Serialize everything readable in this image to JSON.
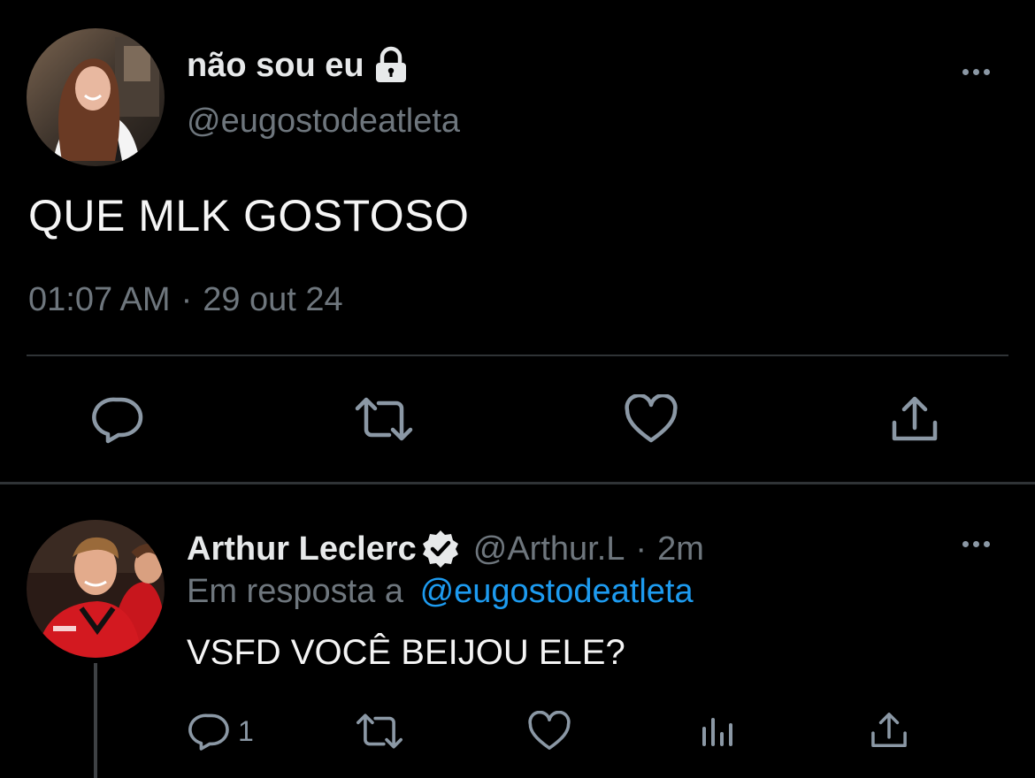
{
  "main_tweet": {
    "display_name": "não sou eu",
    "handle": "@eugostodeatleta",
    "text": "QUE MLK GOSTOSO",
    "time": "01:07 AM",
    "separator": "·",
    "date": "29 out 24",
    "icons": {
      "lock": "lock-icon",
      "more": "more-icon",
      "reply": "reply-icon",
      "retweet": "retweet-icon",
      "like": "like-icon",
      "share": "share-icon"
    }
  },
  "reply_tweet": {
    "display_name": "Arthur Leclerc",
    "handle": "@Arthur.L",
    "separator": "·",
    "time": "2m",
    "replying_label": "Em resposta a",
    "replying_to": "@eugostodeatleta",
    "text": "VSFD VOCÊ BEIJOU ELE?",
    "reply_count": "1",
    "icons": {
      "verified": "verified-icon",
      "more": "more-icon",
      "reply": "reply-icon",
      "retweet": "retweet-icon",
      "like": "like-icon",
      "views": "views-icon",
      "share": "share-icon"
    }
  },
  "colors": {
    "background": "#000000",
    "text": "#e7e9ea",
    "muted": "#6e767d",
    "link": "#1d9bf0",
    "divider": "#2f3336"
  }
}
